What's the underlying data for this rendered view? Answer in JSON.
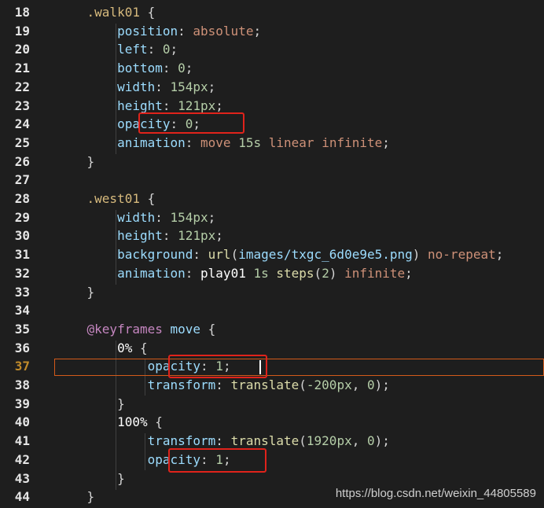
{
  "editor": {
    "lines": [
      {
        "n": "18",
        "parts": [
          [
            "tok-punc",
            "    "
          ],
          [
            "tok-sel",
            ".walk01"
          ],
          [
            "tok-punc",
            " {"
          ]
        ]
      },
      {
        "n": "19",
        "parts": [
          [
            "tok-punc",
            "        "
          ],
          [
            "tok-prop",
            "position"
          ],
          [
            "tok-punc",
            ": "
          ],
          [
            "tok-kw",
            "absolute"
          ],
          [
            "tok-punc",
            ";"
          ]
        ]
      },
      {
        "n": "20",
        "parts": [
          [
            "tok-punc",
            "        "
          ],
          [
            "tok-prop",
            "left"
          ],
          [
            "tok-punc",
            ": "
          ],
          [
            "tok-num",
            "0"
          ],
          [
            "tok-punc",
            ";"
          ]
        ]
      },
      {
        "n": "21",
        "parts": [
          [
            "tok-punc",
            "        "
          ],
          [
            "tok-prop",
            "bottom"
          ],
          [
            "tok-punc",
            ": "
          ],
          [
            "tok-num",
            "0"
          ],
          [
            "tok-punc",
            ";"
          ]
        ]
      },
      {
        "n": "22",
        "parts": [
          [
            "tok-punc",
            "        "
          ],
          [
            "tok-prop",
            "width"
          ],
          [
            "tok-punc",
            ": "
          ],
          [
            "tok-num",
            "154px"
          ],
          [
            "tok-punc",
            ";"
          ]
        ]
      },
      {
        "n": "23",
        "parts": [
          [
            "tok-punc",
            "        "
          ],
          [
            "tok-prop",
            "height"
          ],
          [
            "tok-punc",
            ": "
          ],
          [
            "tok-num",
            "121px"
          ],
          [
            "tok-punc",
            ";"
          ]
        ]
      },
      {
        "n": "24",
        "parts": [
          [
            "tok-punc",
            "        "
          ],
          [
            "tok-prop",
            "opacity"
          ],
          [
            "tok-punc",
            ": "
          ],
          [
            "tok-num",
            "0"
          ],
          [
            "tok-punc",
            ";"
          ]
        ]
      },
      {
        "n": "25",
        "parts": [
          [
            "tok-punc",
            "        "
          ],
          [
            "tok-prop",
            "animation"
          ],
          [
            "tok-punc",
            ": "
          ],
          [
            "tok-kw",
            "move"
          ],
          [
            "tok-punc",
            " "
          ],
          [
            "tok-num",
            "15s"
          ],
          [
            "tok-punc",
            " "
          ],
          [
            "tok-kw",
            "linear"
          ],
          [
            "tok-punc",
            " "
          ],
          [
            "tok-kw",
            "infinite"
          ],
          [
            "tok-punc",
            ";"
          ]
        ]
      },
      {
        "n": "26",
        "parts": [
          [
            "tok-punc",
            "    }"
          ]
        ]
      },
      {
        "n": "27",
        "parts": []
      },
      {
        "n": "28",
        "parts": [
          [
            "tok-punc",
            "    "
          ],
          [
            "tok-sel",
            ".west01"
          ],
          [
            "tok-punc",
            " {"
          ]
        ]
      },
      {
        "n": "29",
        "parts": [
          [
            "tok-punc",
            "        "
          ],
          [
            "tok-prop",
            "width"
          ],
          [
            "tok-punc",
            ": "
          ],
          [
            "tok-num",
            "154px"
          ],
          [
            "tok-punc",
            ";"
          ]
        ]
      },
      {
        "n": "30",
        "parts": [
          [
            "tok-punc",
            "        "
          ],
          [
            "tok-prop",
            "height"
          ],
          [
            "tok-punc",
            ": "
          ],
          [
            "tok-num",
            "121px"
          ],
          [
            "tok-punc",
            ";"
          ]
        ]
      },
      {
        "n": "31",
        "parts": [
          [
            "tok-punc",
            "        "
          ],
          [
            "tok-prop",
            "background"
          ],
          [
            "tok-punc",
            ": "
          ],
          [
            "tok-url",
            "url"
          ],
          [
            "tok-punc",
            "("
          ],
          [
            "tok-path",
            "images/txgc_6d0e9e5.png"
          ],
          [
            "tok-punc",
            ") "
          ],
          [
            "tok-kw",
            "no-repeat"
          ],
          [
            "tok-punc",
            ";"
          ]
        ]
      },
      {
        "n": "32",
        "parts": [
          [
            "tok-punc",
            "        "
          ],
          [
            "tok-prop",
            "animation"
          ],
          [
            "tok-punc",
            ": "
          ],
          [
            "tok-white",
            "play01"
          ],
          [
            "tok-punc",
            " "
          ],
          [
            "tok-num",
            "1s"
          ],
          [
            "tok-punc",
            " "
          ],
          [
            "tok-url",
            "steps"
          ],
          [
            "tok-punc",
            "("
          ],
          [
            "tok-num",
            "2"
          ],
          [
            "tok-punc",
            ") "
          ],
          [
            "tok-kw",
            "infinite"
          ],
          [
            "tok-punc",
            ";"
          ]
        ]
      },
      {
        "n": "33",
        "parts": [
          [
            "tok-punc",
            "    }"
          ]
        ]
      },
      {
        "n": "34",
        "parts": []
      },
      {
        "n": "35",
        "parts": [
          [
            "tok-punc",
            "    "
          ],
          [
            "tok-at",
            "@keyframes"
          ],
          [
            "tok-punc",
            " "
          ],
          [
            "tok-prop",
            "move"
          ],
          [
            "tok-punc",
            " {"
          ]
        ]
      },
      {
        "n": "36",
        "parts": [
          [
            "tok-punc",
            "        "
          ],
          [
            "tok-white",
            "0%"
          ],
          [
            "tok-punc",
            " {"
          ]
        ]
      },
      {
        "n": "37",
        "parts": [
          [
            "tok-punc",
            "            "
          ],
          [
            "tok-prop",
            "opacity"
          ],
          [
            "tok-punc",
            ": "
          ],
          [
            "tok-num",
            "1"
          ],
          [
            "tok-punc",
            ";"
          ]
        ]
      },
      {
        "n": "38",
        "parts": [
          [
            "tok-punc",
            "            "
          ],
          [
            "tok-prop",
            "transform"
          ],
          [
            "tok-punc",
            ": "
          ],
          [
            "tok-url",
            "translate"
          ],
          [
            "tok-punc",
            "("
          ],
          [
            "tok-num",
            "-200px"
          ],
          [
            "tok-punc",
            ", "
          ],
          [
            "tok-num",
            "0"
          ],
          [
            "tok-punc",
            ");"
          ]
        ]
      },
      {
        "n": "39",
        "parts": [
          [
            "tok-punc",
            "        }"
          ]
        ]
      },
      {
        "n": "40",
        "parts": [
          [
            "tok-punc",
            "        "
          ],
          [
            "tok-white",
            "100%"
          ],
          [
            "tok-punc",
            " {"
          ]
        ]
      },
      {
        "n": "41",
        "parts": [
          [
            "tok-punc",
            "            "
          ],
          [
            "tok-prop",
            "transform"
          ],
          [
            "tok-punc",
            ": "
          ],
          [
            "tok-url",
            "translate"
          ],
          [
            "tok-punc",
            "("
          ],
          [
            "tok-num",
            "1920px"
          ],
          [
            "tok-punc",
            ", "
          ],
          [
            "tok-num",
            "0"
          ],
          [
            "tok-punc",
            ");"
          ]
        ]
      },
      {
        "n": "42",
        "parts": [
          [
            "tok-punc",
            "            "
          ],
          [
            "tok-prop",
            "opacity"
          ],
          [
            "tok-punc",
            ": "
          ],
          [
            "tok-num",
            "1"
          ],
          [
            "tok-punc",
            ";"
          ]
        ]
      },
      {
        "n": "43",
        "parts": [
          [
            "tok-punc",
            "        }"
          ]
        ]
      },
      {
        "n": "44",
        "parts": [
          [
            "tok-punc",
            "    }"
          ]
        ]
      }
    ],
    "active_line": "37"
  },
  "watermark": "https://blog.csdn.net/weixin_44805589",
  "colors": {
    "background": "#1e1e1e",
    "highlight_box": "#e0231b",
    "current_line_border": "#d35a1a"
  }
}
